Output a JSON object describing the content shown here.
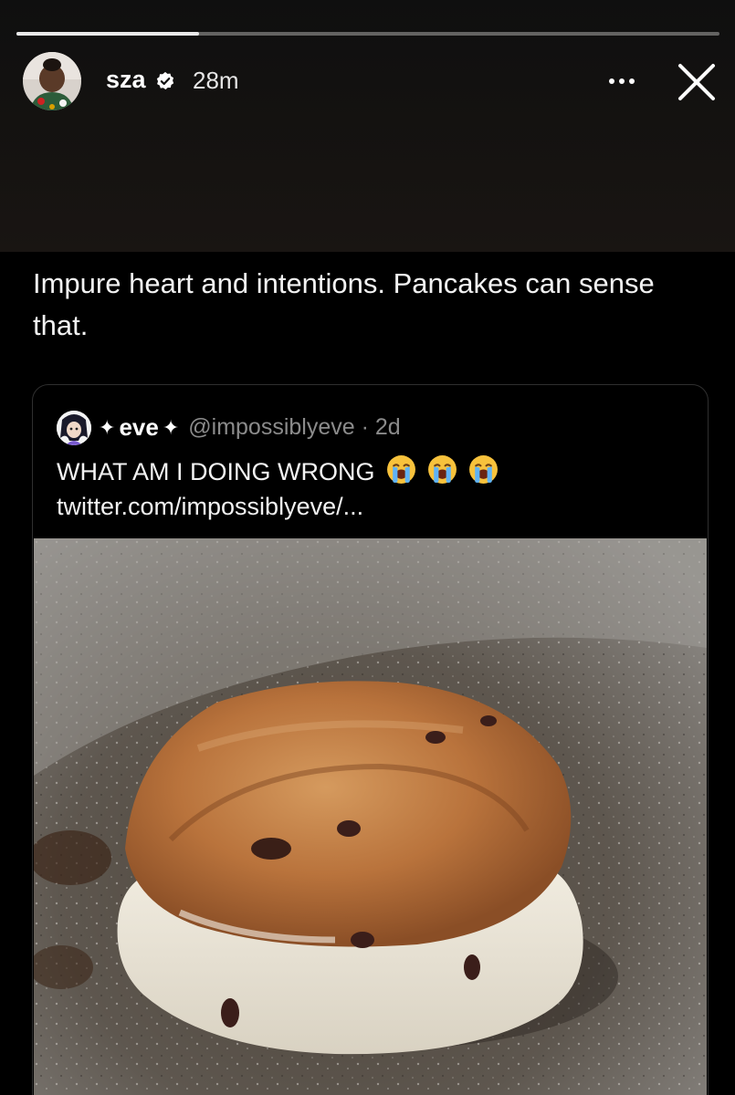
{
  "story": {
    "progress_fraction": 0.26,
    "username": "sza",
    "verified": true,
    "time_ago": "28m",
    "more_icon": "more-horizontal-icon",
    "close_icon": "close-icon"
  },
  "post": {
    "caption": "Impure heart and intentions. Pancakes can sense that."
  },
  "quoted_tweet": {
    "display_name": "eve",
    "name_decoration": "✦",
    "handle_and_time": "@impossiblyeve · 2d",
    "text": "WHAT AM I DOING WRONG",
    "emoji_name": "loudly-crying-face-icon",
    "emoji_count": 3,
    "link": "twitter.com/impossiblyeve/...",
    "image": "photo of a thick, undercooked pancake in a gray speckled frying pan"
  },
  "colors": {
    "background": "#000000",
    "text": "#f2f2f2",
    "muted_text": "#8b8b8b",
    "card_border": "#2f2f2f"
  }
}
